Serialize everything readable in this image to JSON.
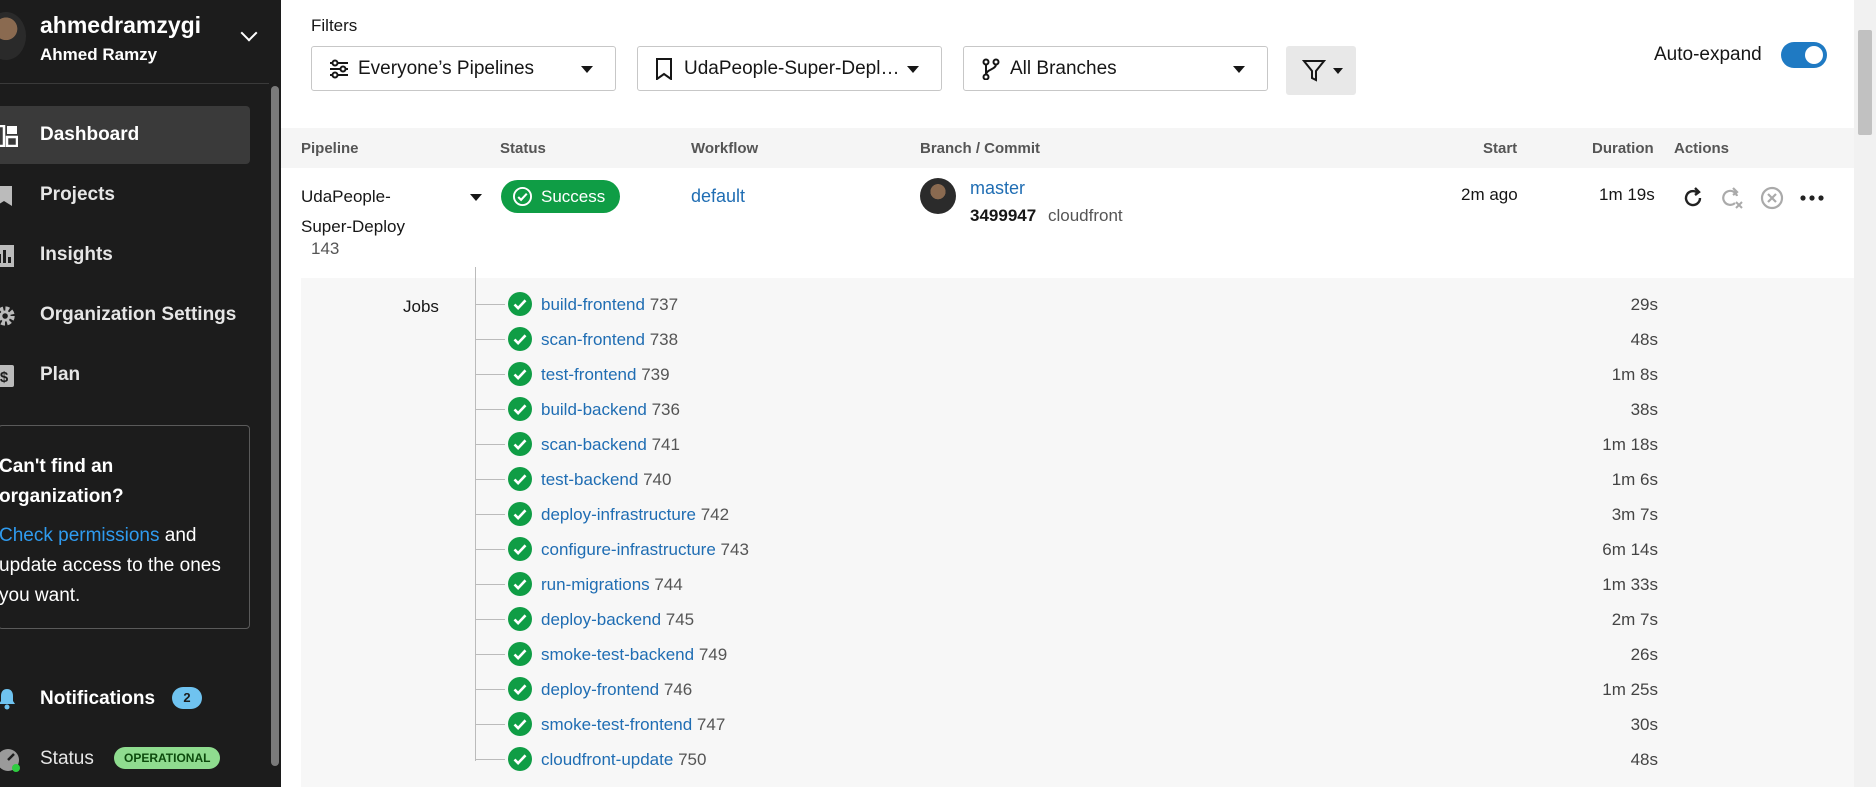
{
  "sidebar": {
    "username": "ahmedramzygi",
    "full_name": "Ahmed Ramzy",
    "nav": [
      {
        "label": "Dashboard",
        "icon": "dashboard-icon",
        "active": true
      },
      {
        "label": "Projects",
        "icon": "bookmark-icon"
      },
      {
        "label": "Insights",
        "icon": "bar-chart-icon"
      },
      {
        "label": "Organization Settings",
        "icon": "gear-icon"
      },
      {
        "label": "Plan",
        "icon": "dollar-icon"
      }
    ],
    "help": {
      "title": "Can't find an organization?",
      "link": "Check permissions",
      "text": " and update access to the ones you want."
    },
    "notifications": {
      "label": "Notifications",
      "count": "2"
    },
    "status": {
      "label": "Status",
      "badge": "OPERATIONAL"
    }
  },
  "filters": {
    "label": "Filters",
    "pipelines": "Everyone’s Pipelines",
    "project": "UdaPeople-Super-Depl…",
    "branches": "All Branches",
    "auto_expand": "Auto-expand"
  },
  "table": {
    "headers": {
      "pipeline": "Pipeline",
      "status": "Status",
      "workflow": "Workflow",
      "branch": "Branch / Commit",
      "start": "Start",
      "duration": "Duration",
      "actions": "Actions"
    },
    "row": {
      "pipeline_name": "UdaPeople-Super-Deploy",
      "pipeline_name_l1": "UdaPeople-",
      "pipeline_name_l2": "Super-Deploy",
      "pipeline_number": "143",
      "status": "Success",
      "workflow": "default",
      "branch": "master",
      "commit_sha": "3499947",
      "commit_message": "cloudfront",
      "start": "2m ago",
      "duration": "1m 19s"
    },
    "jobs_label": "Jobs",
    "jobs": [
      {
        "name": "build-frontend",
        "num": "737",
        "duration": "29s"
      },
      {
        "name": "scan-frontend",
        "num": "738",
        "duration": "48s"
      },
      {
        "name": "test-frontend",
        "num": "739",
        "duration": "1m 8s"
      },
      {
        "name": "build-backend",
        "num": "736",
        "duration": "38s"
      },
      {
        "name": "scan-backend",
        "num": "741",
        "duration": "1m 18s"
      },
      {
        "name": "test-backend",
        "num": "740",
        "duration": "1m 6s"
      },
      {
        "name": "deploy-infrastructure",
        "num": "742",
        "duration": "3m 7s"
      },
      {
        "name": "configure-infrastructure",
        "num": "743",
        "duration": "6m 14s"
      },
      {
        "name": "run-migrations",
        "num": "744",
        "duration": "1m 33s"
      },
      {
        "name": "deploy-backend",
        "num": "745",
        "duration": "2m 7s"
      },
      {
        "name": "smoke-test-backend",
        "num": "749",
        "duration": "26s"
      },
      {
        "name": "deploy-frontend",
        "num": "746",
        "duration": "1m 25s"
      },
      {
        "name": "smoke-test-frontend",
        "num": "747",
        "duration": "30s"
      },
      {
        "name": "cloudfront-update",
        "num": "750",
        "duration": "48s"
      }
    ]
  },
  "colors": {
    "success": "#0f9d45",
    "link": "#1f6db3",
    "sidebar_bg": "#1c1c1c",
    "toggle": "#1f7ac3"
  }
}
